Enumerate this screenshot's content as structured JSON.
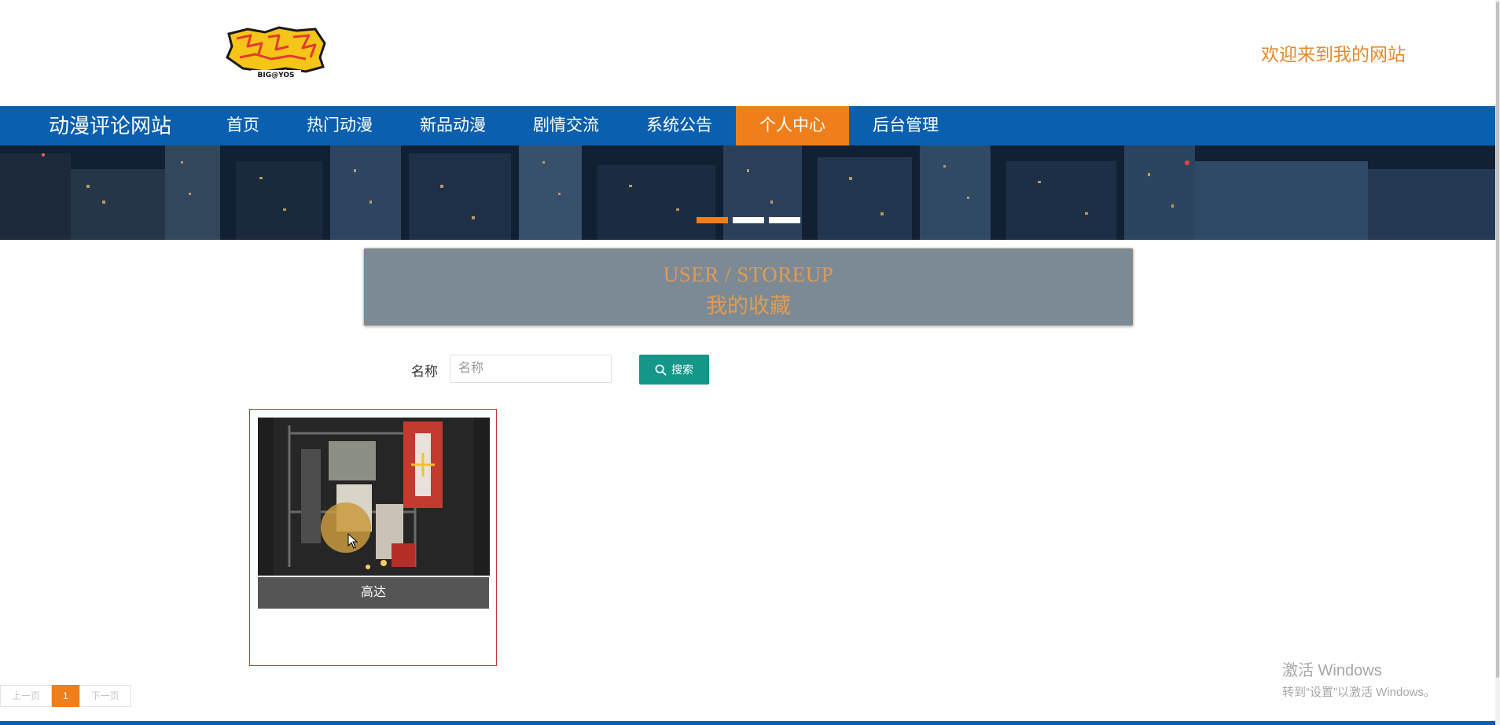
{
  "header": {
    "logo_text": "BIG@YOS",
    "welcome": "欢迎来到我的网站"
  },
  "nav": {
    "brand": "动漫评论网站",
    "items": [
      {
        "label": "首页",
        "active": false
      },
      {
        "label": "热门动漫",
        "active": false
      },
      {
        "label": "新品动漫",
        "active": false
      },
      {
        "label": "剧情交流",
        "active": false
      },
      {
        "label": "系统公告",
        "active": false
      },
      {
        "label": "个人中心",
        "active": true
      },
      {
        "label": "后台管理",
        "active": false
      }
    ]
  },
  "banner": {
    "slide_count": 3,
    "active_index": 0
  },
  "title": {
    "en": "USER / STOREUP",
    "zh": "我的收藏"
  },
  "search": {
    "label": "名称",
    "placeholder": "名称",
    "value": "",
    "button_label": "搜索"
  },
  "favorites": [
    {
      "name": "高达"
    }
  ],
  "pagination": {
    "prev_label": "上一页",
    "current": "1",
    "next_label": "下一页"
  },
  "watermark": {
    "title": "激活 Windows",
    "subtitle": "转到“设置”以激活 Windows。"
  },
  "colors": {
    "nav_bg": "#0a5fae",
    "accent": "#ee7f1b",
    "search_button": "#149688",
    "title_box_bg": "#7c8a96",
    "card_border": "#c9353a"
  }
}
